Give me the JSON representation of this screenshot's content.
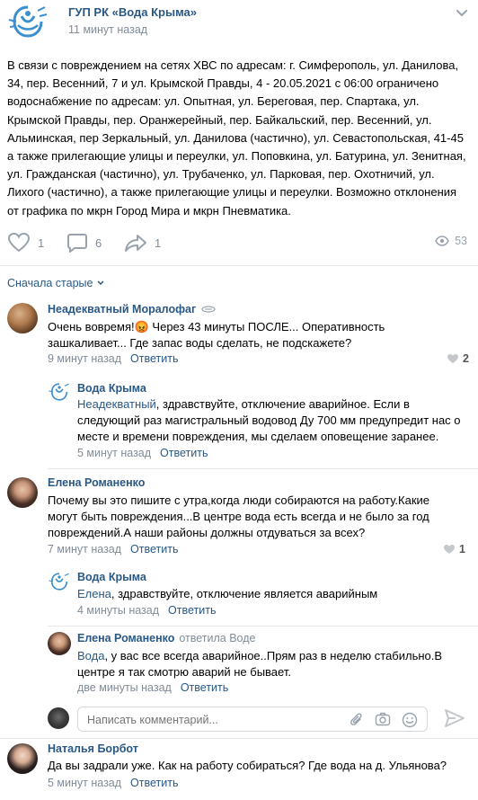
{
  "post": {
    "author": "ГУП РК «Вода Крыма»",
    "time": "11 минут назад",
    "text": "В связи с повреждением на сетях ХВС по адресам: г. Симферополь, ул. Данилова, 34, пер. Весенний, 7 и ул. Крымской Правды, 4 - 20.05.2021 с 06:00 ограничено водоснабжение по адресам: ул. Опытная, ул. Береговая, пер. Спартака, ул. Крымской Правды, пер. Оранжерейный, пер. Байкальский, пер. Весенний, ул. Альминская, пер Зеркальный, ул. Данилова (частично), ул. Севастопольская, 41-45 а также прилегающие улицы и переулки, ул. Поповкина, ул. Батурина, ул. Зенитная, ул. Гражданская (частично), ул. Трубаченко, ул. Парковая, пер. Охотничий, ул. Лихого (частично), а также прилегающие улицы и переулки. Возможно отклонения от графика по мкрн Город Мира и мкрн Пневматика.",
    "likes": "1",
    "comments": "6",
    "shares": "1",
    "views": "53"
  },
  "sort_label": "Сначала старые",
  "comments": [
    {
      "author": "Неадекватный Моралофаг",
      "text": "Очень вовремя!😡 Через 43 минуты ПОСЛЕ... Оперативность зашкаливает... Где запас воды сделать, не подскажете?",
      "time": "9 минут назад",
      "reply_label": "Ответить",
      "likes": "2"
    },
    {
      "author": "Вода Крыма",
      "mention": "Неадекватный",
      "text": ", здравствуйте, отключение аварийное. Если в следующий раз магистральный водовод Ду 700 мм предупредит нас о месте и времени повреждения, мы сделаем оповещение заранее.",
      "time": "5 минут назад",
      "reply_label": "Ответить"
    },
    {
      "author": "Елена Романенко",
      "text": "Почему вы это пишите с утра,когда люди собираются на работу.Какие могут быть повреждения...В центре вода есть всегда и не было за год повреждений.А наши районы должны отдуваться за всех?",
      "time": "7 минут назад",
      "reply_label": "Ответить",
      "likes": "1"
    },
    {
      "author": "Вода Крыма",
      "mention": "Елена",
      "text": ", здравствуйте, отключение является аварийным",
      "time": "4 минуты назад",
      "reply_label": "Ответить"
    },
    {
      "author": "Елена Романенко",
      "replied_to": "ответила Воде",
      "mention": "Вода",
      "text": ", у вас все всегда аварийное..Прям раз в неделю стабильно.В центре я так смотрю аварий не бывает.",
      "time": "две минуты назад",
      "reply_label": "Ответить"
    },
    {
      "author": "Наталья Борбот",
      "text": "Да вы задрали уже. Как на работу собираться? Где вода на д. Ульянова?",
      "time": "5 минут назад",
      "reply_label": "Ответить"
    }
  ],
  "comment_input": {
    "placeholder": "Написать комментарий..."
  },
  "colors": {
    "link": "#2a5885",
    "meta": "#818c99",
    "icon": "#99a2ad",
    "logo": "#3a8fd0"
  }
}
